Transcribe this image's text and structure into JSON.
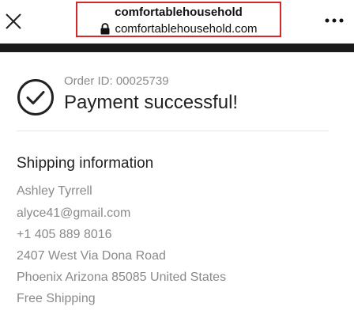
{
  "browser": {
    "site_title": "comfortablehousehold",
    "url": "comfortablehousehold.com",
    "icons": {
      "close": "close-icon",
      "lock": "lock-icon",
      "more": "more-options-icon"
    }
  },
  "order": {
    "id_text": "Order ID: 00025739",
    "status": "Payment successful!",
    "status_icon": "checkmark-circle-icon"
  },
  "shipping": {
    "title": "Shipping information",
    "name": "Ashley  Tyrrell",
    "email": "alyce41@gmail.com",
    "phone": "+1 405 889 8016",
    "street": "2407 West Via Dona Road",
    "city_line": "Phoenix  Arizona  85085 United States",
    "method": "Free Shipping"
  },
  "colors": {
    "highlight_border": "#d6282b",
    "muted_text": "#8a8a8a",
    "dark_strip": "#1a1a1a"
  }
}
